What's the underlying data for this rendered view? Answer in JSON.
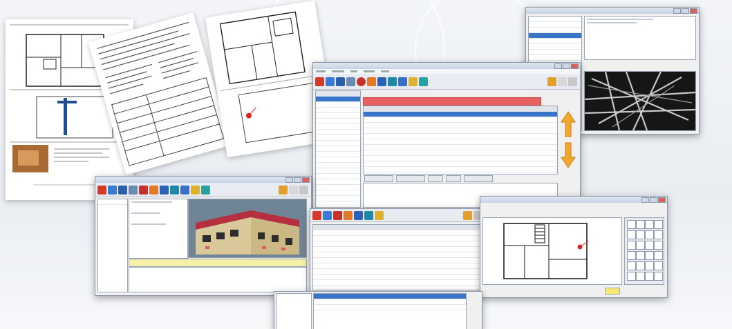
{
  "colors": {
    "background": "#eef1f5",
    "window_title": "#c9d6e8",
    "selection": "#3874c8",
    "alert_bar": "#e86060",
    "arrow": "#f0a830",
    "building_roof": "#c0384a",
    "building_wall": "#d8c89a"
  },
  "icons": [
    "home-icon",
    "folder-icon",
    "save-icon",
    "print-icon",
    "target-icon",
    "camera-icon",
    "map-icon",
    "tag-icon",
    "arrow-up-icon",
    "arrow-down-icon",
    "exit-icon"
  ],
  "main_window": {
    "sidebar_rows": [
      {
        "text": "",
        "style": "sel"
      },
      {
        "text": "",
        "style": ""
      },
      {
        "text": "",
        "style": "red"
      },
      {
        "text": "",
        "style": "red"
      },
      {
        "text": "",
        "style": ""
      },
      {
        "text": "",
        "style": "red"
      },
      {
        "text": "",
        "style": ""
      },
      {
        "text": "",
        "style": ""
      },
      {
        "text": "",
        "style": ""
      },
      {
        "text": "",
        "style": "red"
      },
      {
        "text": "",
        "style": ""
      },
      {
        "text": "",
        "style": ""
      },
      {
        "text": "",
        "style": ""
      },
      {
        "text": "",
        "style": ""
      },
      {
        "text": "",
        "style": "red"
      },
      {
        "text": "",
        "style": ""
      },
      {
        "text": "",
        "style": "red"
      },
      {
        "text": "",
        "style": "red"
      },
      {
        "text": "",
        "style": ""
      }
    ],
    "table_rows": 14
  },
  "building_window": {
    "tree_items": 1
  },
  "grid_window": {
    "rows": 11
  },
  "plan_window": {
    "palette_buttons": 24
  },
  "image_window": {
    "list_items": 10
  }
}
